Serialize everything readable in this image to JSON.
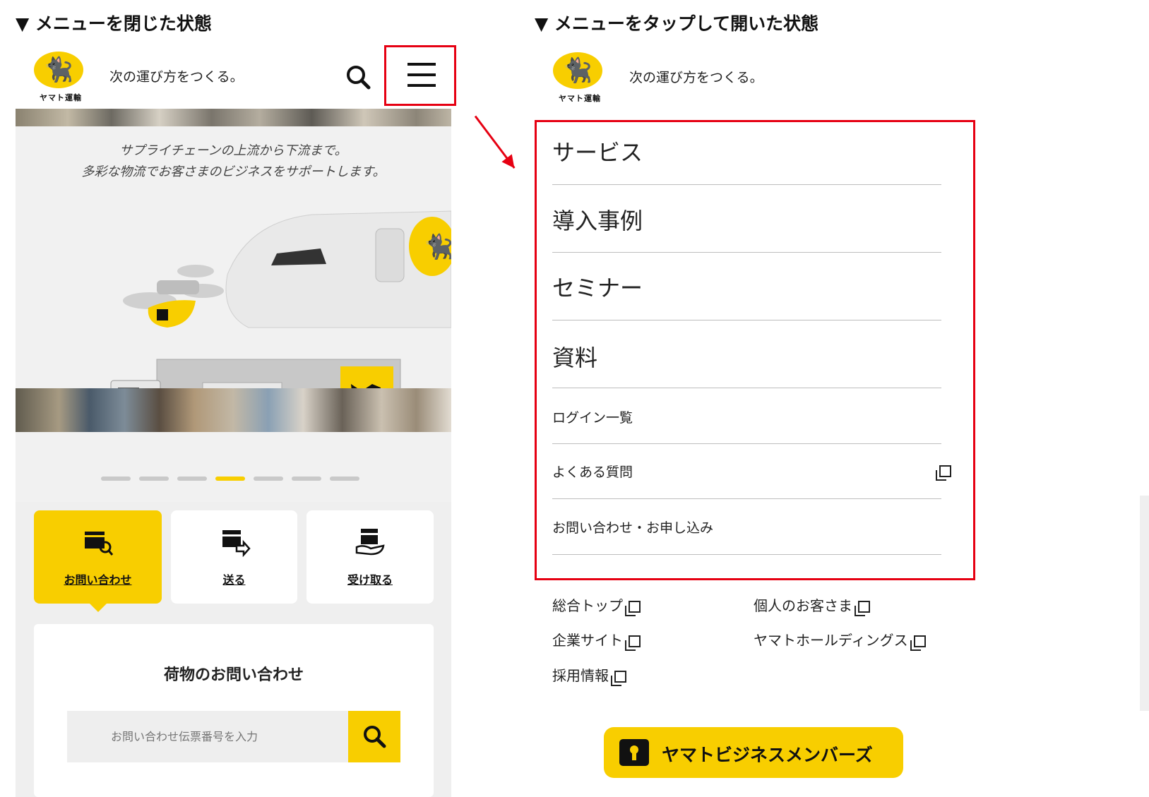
{
  "captions": {
    "closed": "▼ メニューを閉じた状態",
    "opened": "▼ メニューをタップして開いた状態"
  },
  "brand": {
    "logo_text": "ヤマト運輸",
    "tagline": "次の運び方をつくる。",
    "accent": "#f8ce00",
    "highlight": "#e60012"
  },
  "hero": {
    "line1": "サプライチェーンの上流から下流まで。",
    "line2": "多彩な物流でお客さまのビジネスをサポートします。",
    "slide_count": 7,
    "active_slide": 4
  },
  "tabs": [
    {
      "label": "お問い合わせ",
      "icon": "box-search-icon",
      "active": true
    },
    {
      "label": "送る",
      "icon": "box-send-icon",
      "active": false
    },
    {
      "label": "受け取る",
      "icon": "box-receive-icon",
      "active": false
    }
  ],
  "tracking": {
    "title": "荷物のお問い合わせ",
    "placeholder": "お問い合わせ伝票番号を入力"
  },
  "menu": {
    "primary": [
      "サービス",
      "導入事例",
      "セミナー",
      "資料"
    ],
    "secondary": [
      "ログイン一覧",
      "よくある質問",
      "お問い合わせ・お申し込み"
    ]
  },
  "footer_links": {
    "col1": [
      "総合トップ",
      "企業サイト",
      "採用情報"
    ],
    "col2": [
      "個人のお客さま",
      "ヤマトホールディングス"
    ]
  },
  "member_button": "ヤマトビジネスメンバーズ"
}
